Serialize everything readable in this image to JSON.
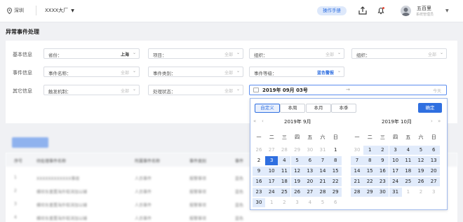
{
  "topbar": {
    "location": "深圳",
    "factory": "XXXX大厂",
    "manual_label": "操作手册",
    "user_name": "五百里",
    "user_role": "系统管理员"
  },
  "page": {
    "title": "异常事件处理"
  },
  "filters": {
    "basic_label": "基本信息",
    "event_label": "事件信息",
    "other_label": "其它信息",
    "province": {
      "label": "省份：",
      "value": "上海"
    },
    "project": {
      "label": "项目：",
      "value": "全部"
    },
    "org1": {
      "label": "组织：",
      "value": "全部"
    },
    "org2": {
      "label": "组织：",
      "value": "全部"
    },
    "event_name": {
      "label": "事件名称：",
      "value": "全部"
    },
    "event_type": {
      "label": "事件类别：",
      "value": "全部"
    },
    "event_level": {
      "label": "事件等级：",
      "value": "蓝色警报"
    },
    "trigger": {
      "label": "触发机制：",
      "value": "全部"
    },
    "status": {
      "label": "处理状态：",
      "value": "全部"
    },
    "date_start": "2019年 09月 03号",
    "date_end": "今天",
    "range_sep": "→"
  },
  "table": {
    "headers": [
      "序号",
      "待处理事件名称",
      "所属事件名称",
      "事件类别",
      "事件"
    ],
    "rows": [
      [
        "1",
        "XXXXXXXXXXXX事故",
        "人员事件",
        "报警事项",
        "蓝色"
      ],
      [
        "2",
        "横坝东重置海外取消加以辅",
        "人员事件",
        "报警事项",
        "蓝色"
      ],
      [
        "3",
        "横坝东重置海外取消加以辅",
        "人员事件",
        "报警事项",
        "蓝色"
      ],
      [
        "4",
        "横坝东重置海外取消加以辅",
        "人员事件",
        "报警事项",
        "蓝色"
      ]
    ]
  },
  "picker": {
    "quick": [
      "自定义",
      "本周",
      "本月",
      "本季"
    ],
    "confirm": "确定",
    "weekdays": [
      "一",
      "二",
      "三",
      "四",
      "五",
      "六",
      "日"
    ],
    "left": {
      "title": "2019年  9月",
      "days": [
        "26",
        "27",
        "28",
        "29",
        "30",
        "31",
        "1",
        "2",
        "3",
        "4",
        "5",
        "6",
        "7",
        "8",
        "9",
        "10",
        "11",
        "12",
        "13",
        "14",
        "15",
        "16",
        "17",
        "18",
        "19",
        "20",
        "21",
        "22",
        "23",
        "24",
        "25",
        "26",
        "27",
        "28",
        "29",
        "30",
        "1",
        "2",
        "3",
        "4",
        "5",
        "6"
      ]
    },
    "right": {
      "title": "2019年  10月",
      "days": [
        "30",
        "1",
        "2",
        "3",
        "4",
        "5",
        "6",
        "7",
        "8",
        "9",
        "10",
        "11",
        "12",
        "13",
        "14",
        "15",
        "16",
        "17",
        "18",
        "19",
        "20",
        "21",
        "22",
        "23",
        "24",
        "25",
        "26",
        "27",
        "28",
        "29",
        "30",
        "31",
        "1",
        "2",
        "3"
      ]
    }
  }
}
